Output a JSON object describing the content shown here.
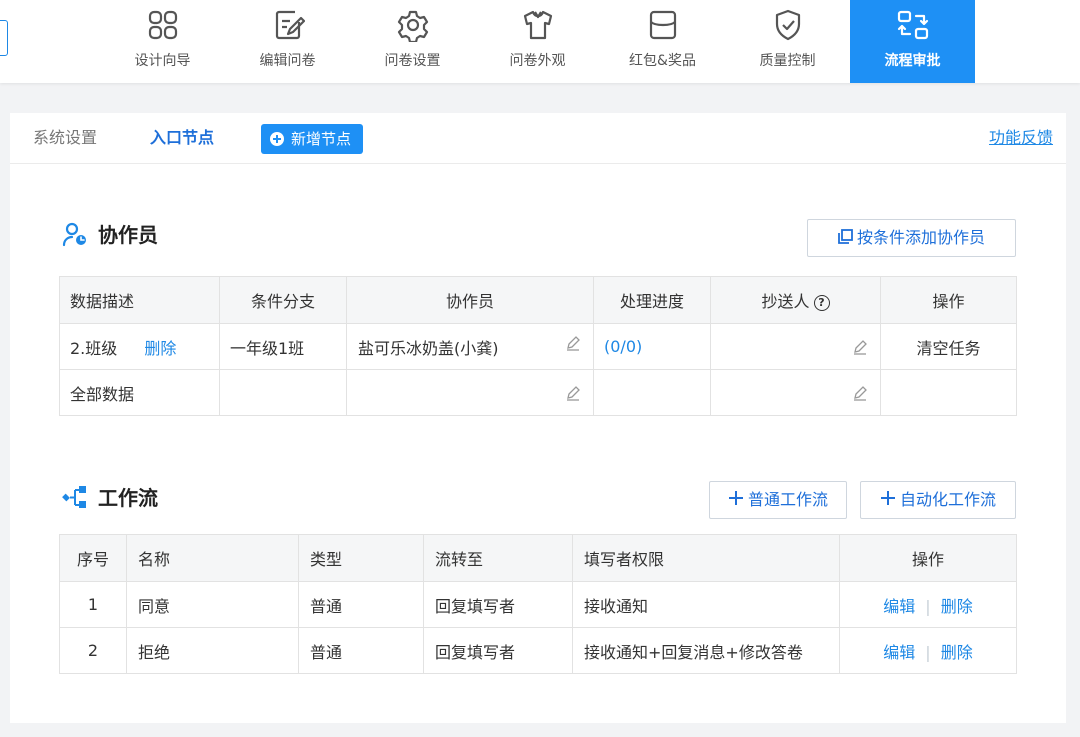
{
  "nav": {
    "items": [
      {
        "label": "设计向导",
        "icon": "grid-icon"
      },
      {
        "label": "编辑问卷",
        "icon": "edit-doc-icon"
      },
      {
        "label": "问卷设置",
        "icon": "gear-icon"
      },
      {
        "label": "问卷外观",
        "icon": "shirt-icon"
      },
      {
        "label": "红包&奖品",
        "icon": "gift-box-icon"
      },
      {
        "label": "质量控制",
        "icon": "shield-check-icon"
      },
      {
        "label": "流程审批",
        "icon": "flow-approve-icon",
        "active": true
      }
    ],
    "accent": "#1e90f5"
  },
  "subtabs": {
    "system": "系统设置",
    "entry": "入口节点",
    "add_node": "新增节点",
    "feedback": "功能反馈"
  },
  "collaborators": {
    "title": "协作员",
    "add_button": "按条件添加协作员",
    "columns": [
      "数据描述",
      "条件分支",
      "协作员",
      "处理进度",
      "抄送人",
      "操作"
    ],
    "rows": [
      {
        "desc": "2.班级",
        "delete": "删除",
        "branch": "一年级1班",
        "collaborator": "盐可乐冰奶盖(小龚)",
        "progress": "(0/0)",
        "cc": "",
        "action": "清空任务"
      },
      {
        "desc": "全部数据",
        "delete": "",
        "branch": "",
        "collaborator": "",
        "progress": "",
        "cc": "",
        "action": ""
      }
    ]
  },
  "workflow": {
    "title": "工作流",
    "normal_button": "普通工作流",
    "auto_button": "自动化工作流",
    "columns": [
      "序号",
      "名称",
      "类型",
      "流转至",
      "填写者权限",
      "操作"
    ],
    "rows": [
      {
        "index": "1",
        "name": "同意",
        "type": "普通",
        "flow_to": "回复填写者",
        "permission": "接收通知",
        "edit": "编辑",
        "delete": "删除"
      },
      {
        "index": "2",
        "name": "拒绝",
        "type": "普通",
        "flow_to": "回复填写者",
        "permission": "接收通知+回复消息+修改答卷",
        "edit": "编辑",
        "delete": "删除"
      }
    ]
  }
}
